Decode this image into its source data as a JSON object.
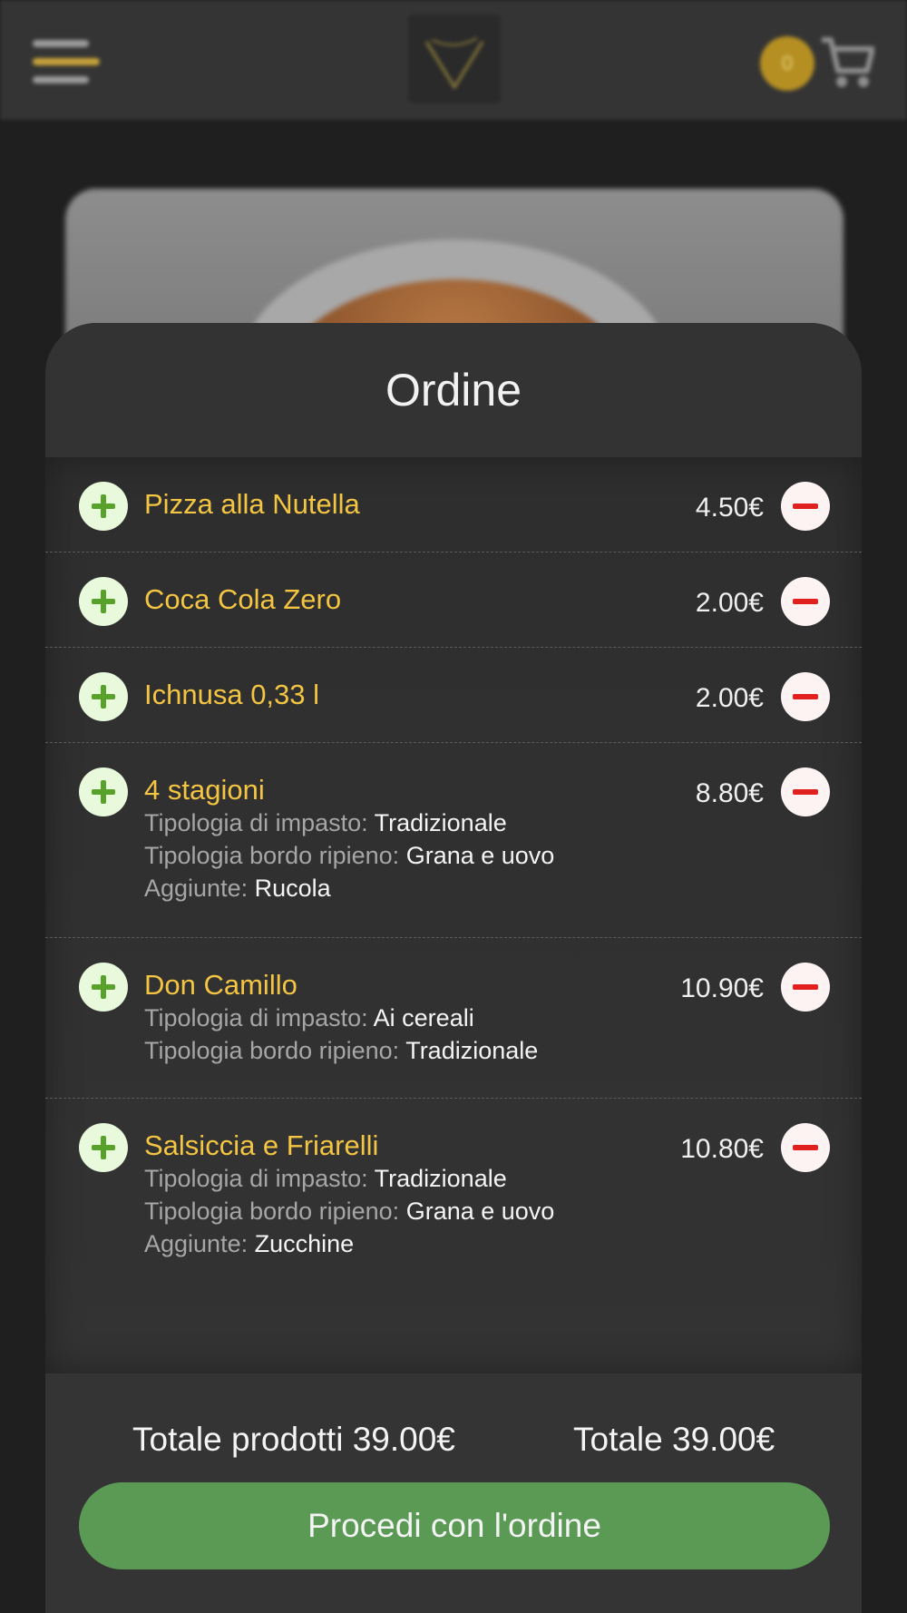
{
  "header": {
    "cart_count": "0"
  },
  "sheet": {
    "title": "Ordine"
  },
  "order_items": [
    {
      "name": "Pizza alla Nutella",
      "price": "4.50€",
      "options": []
    },
    {
      "name": "Coca Cola Zero",
      "price": "2.00€",
      "options": []
    },
    {
      "name": "Ichnusa 0,33 l",
      "price": "2.00€",
      "options": []
    },
    {
      "name": "4 stagioni",
      "price": "8.80€",
      "options": [
        {
          "label": "Tipologia di impasto:",
          "value": "Tradizionale"
        },
        {
          "label": "Tipologia bordo ripieno:",
          "value": "Grana e uovo"
        },
        {
          "label": "Aggiunte:",
          "value": "Rucola"
        }
      ]
    },
    {
      "name": "Don Camillo",
      "price": "10.90€",
      "options": [
        {
          "label": "Tipologia di impasto:",
          "value": "Ai cereali"
        },
        {
          "label": "Tipologia bordo ripieno:",
          "value": "Tradizionale"
        }
      ]
    },
    {
      "name": "Salsiccia e Friarelli",
      "price": "10.80€",
      "options": [
        {
          "label": "Tipologia di impasto:",
          "value": "Tradizionale"
        },
        {
          "label": "Tipologia bordo ripieno:",
          "value": "Grana e uovo"
        },
        {
          "label": "Aggiunte:",
          "value": "Zucchine"
        }
      ]
    }
  ],
  "footer": {
    "products_total": "Totale prodotti 39.00€",
    "total": "Totale 39.00€",
    "proceed_label": "Procedi con l'ordine"
  },
  "colors": {
    "accent_yellow": "#f4c542",
    "plus_green": "#58a12a",
    "minus_red": "#e0201f",
    "proceed_green": "#5a9a55"
  }
}
